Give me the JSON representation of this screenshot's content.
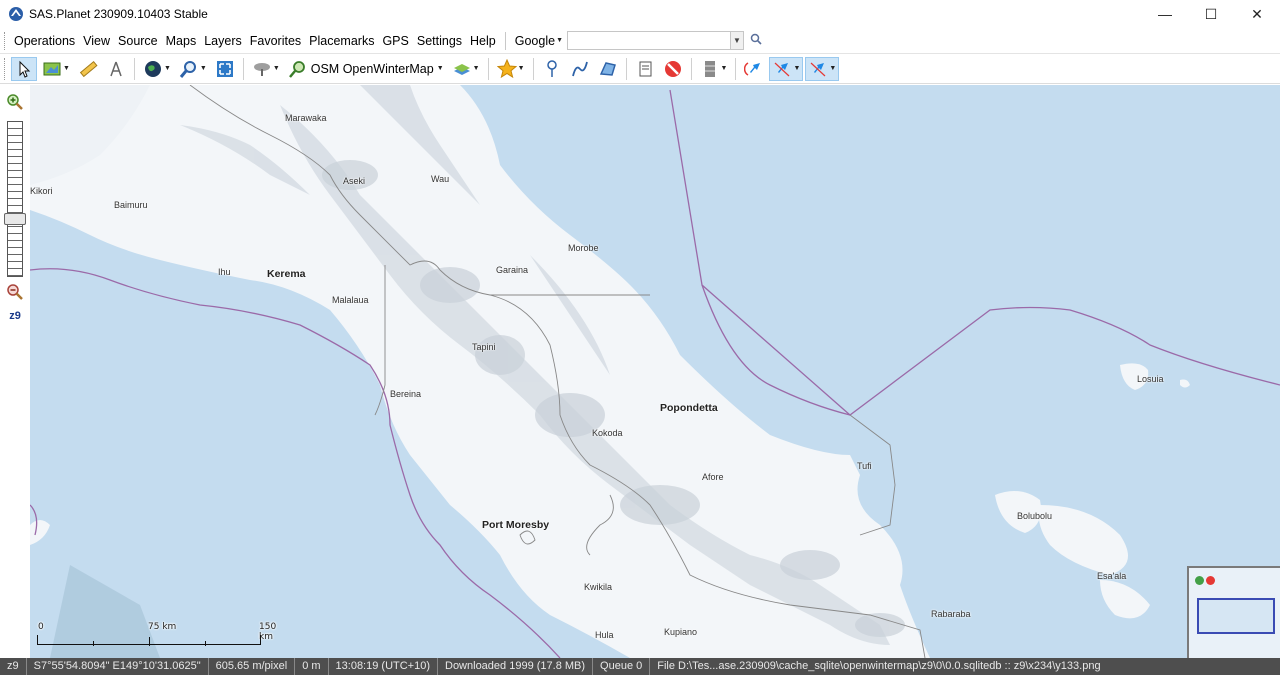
{
  "window": {
    "title": "SAS.Planet 230909.10403 Stable",
    "minimize_glyph": "—",
    "maximize_glyph": "☐",
    "close_glyph": "✕"
  },
  "menu": {
    "items": [
      "Operations",
      "View",
      "Source",
      "Maps",
      "Layers",
      "Favorites",
      "Placemarks",
      "GPS",
      "Settings",
      "Help"
    ],
    "search_engine": "Google",
    "search_value": ""
  },
  "toolbar": {
    "map_name": "OSM OpenWinterMap"
  },
  "sidebar": {
    "zoom_level": "z9"
  },
  "map": {
    "places": [
      {
        "name": "Marawaka",
        "kind": "village"
      },
      {
        "name": "Aseki",
        "kind": "village"
      },
      {
        "name": "Wau",
        "kind": "village"
      },
      {
        "name": "Kikori",
        "kind": "village"
      },
      {
        "name": "Baimuru",
        "kind": "village"
      },
      {
        "name": "Morobe",
        "kind": "village"
      },
      {
        "name": "Ihu",
        "kind": "village"
      },
      {
        "name": "Kerema",
        "kind": "town"
      },
      {
        "name": "Garaina",
        "kind": "village"
      },
      {
        "name": "Malalaua",
        "kind": "village"
      },
      {
        "name": "Tapini",
        "kind": "village"
      },
      {
        "name": "Losuia",
        "kind": "village"
      },
      {
        "name": "Bereina",
        "kind": "village"
      },
      {
        "name": "Popondetta",
        "kind": "town"
      },
      {
        "name": "Kokoda",
        "kind": "village"
      },
      {
        "name": "Tufi",
        "kind": "village"
      },
      {
        "name": "Afore",
        "kind": "village"
      },
      {
        "name": "Bolubolu",
        "kind": "village"
      },
      {
        "name": "Port Moresby",
        "kind": "town"
      },
      {
        "name": "Esa'ala",
        "kind": "village"
      },
      {
        "name": "Kwikila",
        "kind": "village"
      },
      {
        "name": "Rabaraba",
        "kind": "village"
      },
      {
        "name": "Hula",
        "kind": "village"
      },
      {
        "name": "Kupiano",
        "kind": "village"
      }
    ],
    "scale": {
      "zero": "0",
      "mid": "75 km",
      "end": "150 km"
    },
    "colors": {
      "water": "#c4dcef",
      "land": "#f3f6f9",
      "border": "#9b6aa8"
    }
  },
  "status": {
    "zoom": "z9",
    "coords": "S7°55'54.8094\" E149°10'31.0625\"",
    "resolution": "605.65 m/pixel",
    "altitude": "0 m",
    "time": "13:08:19 (UTC+10)",
    "downloaded": "Downloaded 1999 (17.8 MB)",
    "queue": "Queue 0",
    "file": "File D:\\Tes...ase.230909\\cache_sqlite\\openwintermap\\z9\\0\\0.0.sqlitedb :: z9\\x234\\y133.png"
  }
}
